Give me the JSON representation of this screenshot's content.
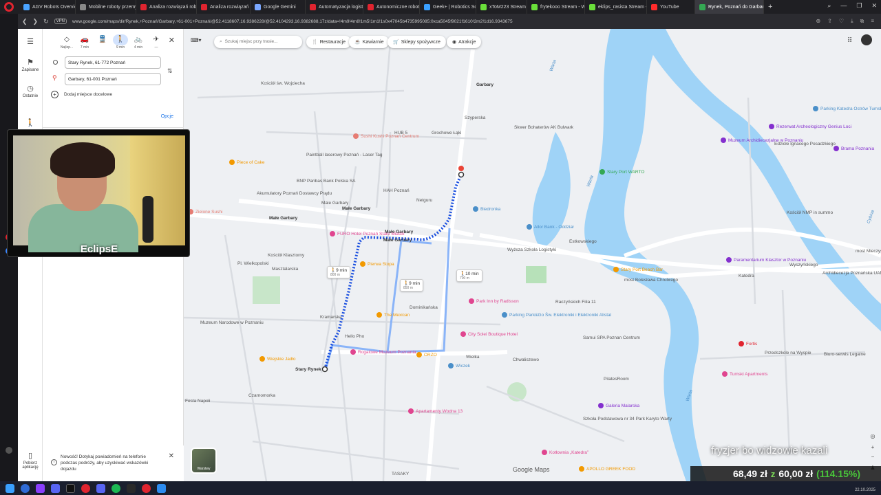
{
  "browser": {
    "tabs": [
      {
        "label": "AGV Robots Overview | F",
        "color": "#4aa3ff"
      },
      {
        "label": "Mobilne roboty przemysł",
        "color": "#888888"
      },
      {
        "label": "Analiza rozwiązań robotó",
        "color": "#e0242f"
      },
      {
        "label": "Analiza rozwiązań AMR",
        "color": "#e0242f"
      },
      {
        "label": "Google Gemini",
        "color": "#7aa7ff"
      },
      {
        "label": "Automatyzacja logistyki w",
        "color": "#e0242f"
      },
      {
        "label": "Autonomiczne roboty mo",
        "color": "#e0242f"
      },
      {
        "label": "Geek+ | Robotics Solution",
        "color": "#3aa0ff"
      },
      {
        "label": "xToM223 Stream - W",
        "color": "#6adf3a"
      },
      {
        "label": "frytekooo Stream - W",
        "color": "#6adf3a"
      },
      {
        "label": "eklips_rasista Stream - Kic",
        "color": "#6adf3a"
      },
      {
        "label": "YouTube",
        "color": "#ff2b2b"
      },
      {
        "label": "Rynek, Poznań do Garbar",
        "color": "#34a853",
        "active": true
      }
    ],
    "url": "www.google.com/maps/dir/Rynek,+Poznań/Garbary,+61-001+Poznań/@52.4118607,16.9386228/@52.4104293,16.9382688,17z/data=!4m9!4m8!1m5!1m1!1s0x47045b4735995085:0xca5045f9021f1610!2m2!1d16.9343675!2d52.4082496!1m0!3e2",
    "vpn": "VPN"
  },
  "rail": {
    "menu": "☰",
    "saved": "Zapisane",
    "recent": "Ostatnie",
    "download": "Pobierz aplikację"
  },
  "panel": {
    "modes": [
      {
        "icon": "◇",
        "label": "Najlep...",
        "name": "best"
      },
      {
        "icon": "🚗",
        "label": "7 min",
        "name": "car"
      },
      {
        "icon": "🚆",
        "label": "",
        "name": "transit"
      },
      {
        "icon": "🚶",
        "label": "9 min",
        "name": "walk",
        "active": true
      },
      {
        "icon": "🚲",
        "label": "4 min",
        "name": "bike"
      },
      {
        "icon": "✈",
        "label": "—",
        "name": "flight"
      }
    ],
    "origin": "Stary Rynek, 61-772 Poznań",
    "destination": "Garbary, 61-001 Poznań",
    "add_destination": "Dodaj miejsce docelowe",
    "options": "Opcje",
    "notification": "Nowość! Dotykaj powiadomień na telefonie podczas podróży, aby uzyskiwać wskazówki dojazdu"
  },
  "webcam": {
    "name": "EclipsE"
  },
  "map": {
    "search_placeholder": "Szukaj miejsc przy trasie...",
    "chips": [
      "Restauracje",
      "Kawiarnie",
      "Sklepy spożywcze",
      "Atrakcje"
    ],
    "layers_label": "Warstwy",
    "brand": "Google Maps",
    "route_chips": [
      {
        "time": "9 min",
        "dist": "800 m"
      },
      {
        "time": "9 min",
        "dist": "850 m"
      },
      {
        "time": "10 min",
        "dist": "700 m"
      }
    ],
    "labels": {
      "st_wojciech": "Kościół św. Wojciecha",
      "garbary_top": "Garbary",
      "szyperska": "Szyperska",
      "grochowe": "Grochowe Łąki",
      "hub5": "HUB 5",
      "sushi": "Sushi Kushi Poznań Centrum",
      "bastion": "Skwer Bohaterów AK Bulwark",
      "paintball": "Paintball laserowy Poznań - Laser Tag",
      "piece": "Piece of Cake",
      "bnp": "BNP Paribas Bank Polska SA",
      "hah": "HAH Poznań",
      "akumulatory": "Akumulatory Poznań Dostawcy Prądu",
      "netguru": "Netguru",
      "male_garbary_1": "Małe Garbary",
      "male_garbary_2": "Małe Garbary",
      "male_garbary_3": "Małe Garbary",
      "male_garbary_4": "Małe Garbary",
      "male_garbary_5": "Male Garbary",
      "zielone": "Zielone Sushi",
      "furo": "FURO Hotel Poznań Stare Miasto",
      "biedronka": "Biedronka",
      "allor": "Allor Bank - Oddział",
      "estkowskiego": "Estkowskiego",
      "pl_wielkopolski": "Pl. Wielkopolski",
      "kosciol_klaszt": "Kościół Klasztorny",
      "wyzsza": "Wyższa Szkoła Logistyki",
      "pierwa": "Pierwa Stopa",
      "masztalarska": "Masztalarska",
      "dominikanska": "Dominikańska",
      "kramarska": "Kramarska",
      "mexican": "The Mexican",
      "park_inn": "Park Inn by Radisson",
      "muzeum_narodowe": "Muzeum Narodowe w Poznaniu",
      "hello_pho": "Hello Pho",
      "rogalowe": "Rogalowe Muzeum Poznania",
      "city_solei": "City Solei Boutique Hotel",
      "park_go": "Parking Park&Go Św. Elektroniki i Elektroniki Alistal",
      "samui": "Samui SPA Poznan Centrum",
      "orzo": "ORZO",
      "wielka": "Wielka",
      "chwaliszewo": "Chwaliszewo",
      "wiejskie": "Wiejskie Jadło",
      "stary_rynek": "Stary Rynek",
      "czarnomorka": "Czarnomorka",
      "festa": "Festa Napoli",
      "apartamenty": "Apartamenty Wodna 13",
      "tasaky": "TASAKY",
      "wodna": "Wodna",
      "wroniecka": "Wroniecka",
      "piekary": "Piekary",
      "warta_1": "Warta",
      "warta_2": "Warta",
      "warta_3": "Warta",
      "cybina": "Cybina",
      "stary_port": "Stary Port WARTO",
      "parking_katedra": "Parking Katedra Ostrów Tumski",
      "rezerwat": "Rezerwat Archeologiczny Genius Loci",
      "muzeum_arch": "Muzeum Archidiecezjalne w Poznaniu",
      "edzia": "Edziołe Ignacego Posadzkiego",
      "brama": "Brama Poznania",
      "kosciol_nmp": "Kościół NMP in summo",
      "parament": "Paramentarium Klasztor w Poznaniu",
      "stary_port_beach": "Stary Port Beach Bar",
      "boleslawa": "most Bolesława Chrobrego",
      "katedra": "Katedra",
      "wyszynskiego": "Wyszyńskiego",
      "mieczyslawa": "most Mieczysława I",
      "archidiecezja": "Archidiecezja Poznańska UAM",
      "fortis": "Fortis",
      "przedszkole": "Przedszkole na Wyspie",
      "tumski_ap": "Tumski Apartments",
      "biuro": "Biuro-serwis Legalne",
      "racz": "Raczyńskich Filia 11",
      "wiczek": "Wiczek",
      "pilates": "PilatesRoom",
      "szkola": "Szkoła Podstawowa nr 34 Park Karyto Warty",
      "galeria": "Galeria Malarska",
      "kotlownia": "Kotłownia „Katedra”",
      "apollo": "APOLLO GREEK FOOD",
      "stary_rynek_wisk": "Stary Rynek",
      "restauracja_fuso": "Restauracja Fuso Pasta Bar",
      "olie": "Olie"
    }
  },
  "stream": {
    "overlay_text": "fryzjer bo widzowie kazali",
    "amount": "68,49 zł",
    "z": "z",
    "goal": "60,00 zł",
    "percent": "(114.15%)"
  },
  "taskbar": {
    "date": "22.10.2025"
  },
  "colors": {
    "route": "#1a4fe0",
    "route_alt": "#8ab4f8",
    "water": "#9fd3f7",
    "park": "#c8e6c9"
  }
}
